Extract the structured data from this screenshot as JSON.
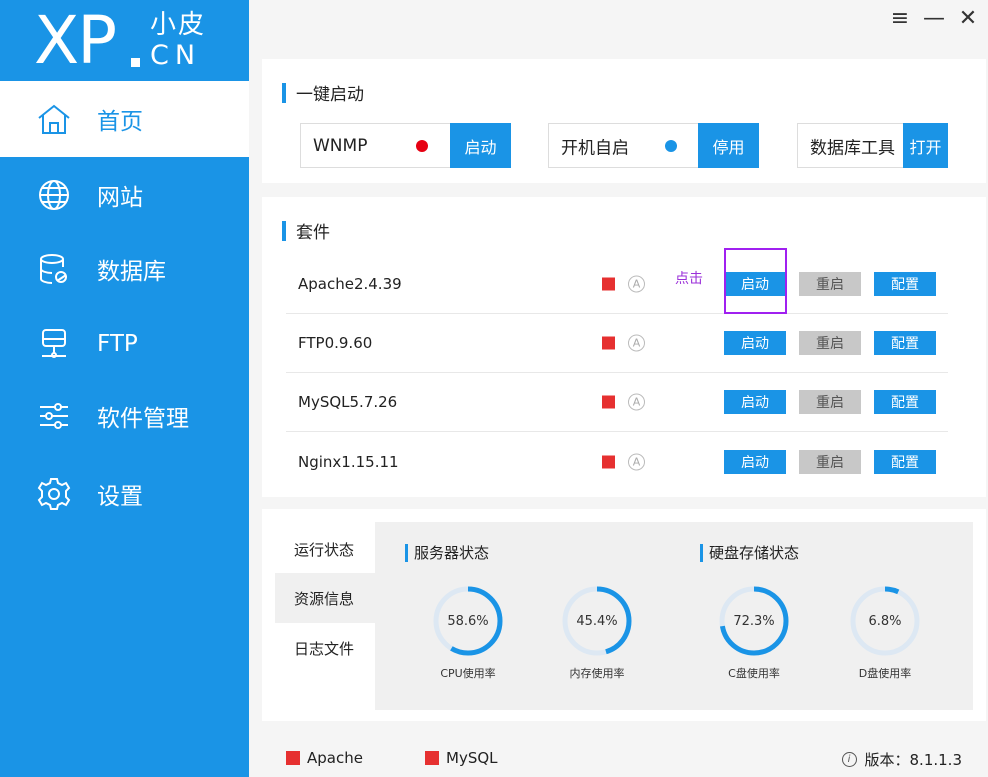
{
  "logo": {
    "main": "XP",
    "cn_top": "小皮",
    "cn_bottom": "CN"
  },
  "sidebar": {
    "items": [
      {
        "label": "首页",
        "icon": "home-icon",
        "active": true
      },
      {
        "label": "网站",
        "icon": "globe-icon",
        "active": false
      },
      {
        "label": "数据库",
        "icon": "database-icon",
        "active": false
      },
      {
        "label": "FTP",
        "icon": "ftp-icon",
        "active": false
      },
      {
        "label": "软件管理",
        "icon": "sliders-icon",
        "active": false
      },
      {
        "label": "设置",
        "icon": "gear-icon",
        "active": false
      }
    ]
  },
  "window": {
    "menu_icon": "≡",
    "minimize_icon": "—",
    "close_icon": "✕"
  },
  "quickstart": {
    "title": "一键启动",
    "items": [
      {
        "label": "WNMP",
        "button": "启动",
        "dot_color": "#e60012"
      },
      {
        "label": "开机自启",
        "button": "停用",
        "dot_color": "#1a94e6"
      },
      {
        "label": "数据库工具",
        "button": "打开"
      }
    ]
  },
  "suite": {
    "title": "套件",
    "hint": "点击",
    "auto_glyph": "A",
    "services": [
      {
        "name": "Apache2.4.39",
        "start": "启动",
        "restart": "重启",
        "config": "配置"
      },
      {
        "name": "FTP0.9.60",
        "start": "启动",
        "restart": "重启",
        "config": "配置"
      },
      {
        "name": "MySQL5.7.26",
        "start": "启动",
        "restart": "重启",
        "config": "配置"
      },
      {
        "name": "Nginx1.15.11",
        "start": "启动",
        "restart": "重启",
        "config": "配置"
      }
    ]
  },
  "tabs": [
    {
      "label": "运行状态",
      "active": false
    },
    {
      "label": "资源信息",
      "active": true
    },
    {
      "label": "日志文件",
      "active": false
    }
  ],
  "stats": {
    "server_title": "服务器状态",
    "disk_title": "硬盘存储状态",
    "gauges": [
      {
        "value": "58.6%",
        "percent": 58.6,
        "label": "CPU使用率"
      },
      {
        "value": "45.4%",
        "percent": 45.4,
        "label": "内存使用率"
      },
      {
        "value": "72.3%",
        "percent": 72.3,
        "label": "C盘使用率"
      },
      {
        "value": "6.8%",
        "percent": 6.8,
        "label": "D盘使用率"
      }
    ]
  },
  "footer": {
    "legend": [
      "Apache",
      "MySQL"
    ],
    "info_glyph": "i",
    "version_label": "版本：",
    "version": "8.1.1.3"
  },
  "colors": {
    "accent": "#1a94e6",
    "stopped": "#e63030",
    "hint": "#a020f0"
  }
}
